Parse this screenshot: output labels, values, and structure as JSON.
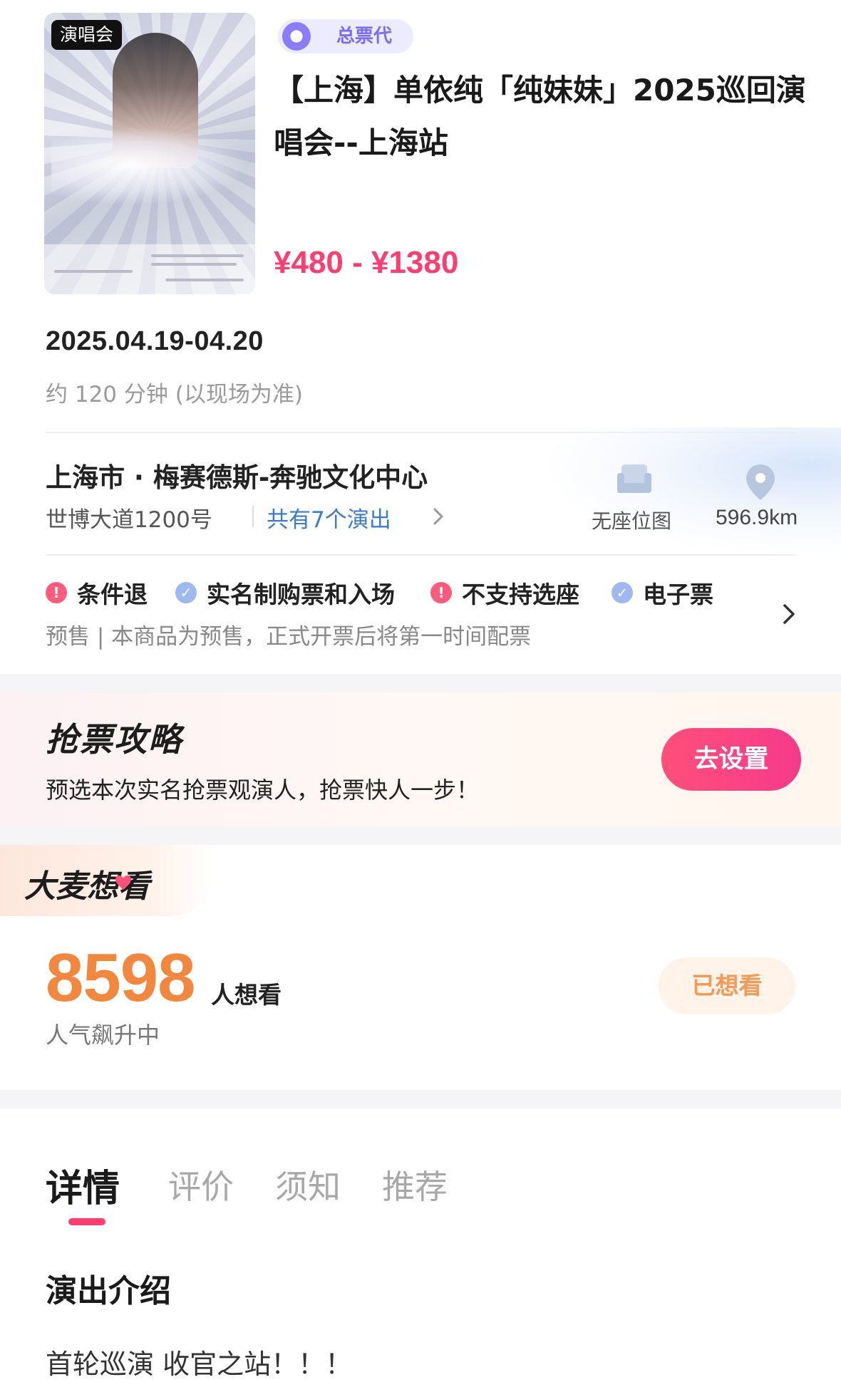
{
  "poster": {
    "category_badge": "演唱会"
  },
  "agent_badge": {
    "label": "总票代"
  },
  "event": {
    "title": "【上海】单依纯「纯妹妹」2025巡回演唱会--上海站",
    "price_range": "¥480 - ¥1380",
    "date": "2025.04.19-04.20",
    "duration": "约 120 分钟 (以现场为准)"
  },
  "venue": {
    "name": "上海市 · 梅赛德斯-奔驰文化中心",
    "address": "世博大道1200号",
    "shows_link": "共有7个演出",
    "seat_map_label": "无座位图",
    "distance": "596.9km"
  },
  "tags": [
    {
      "label": "条件退",
      "kind": "warn"
    },
    {
      "label": "实名制购票和入场",
      "kind": "ok"
    },
    {
      "label": "不支持选座",
      "kind": "warn"
    },
    {
      "label": "电子票",
      "kind": "ok"
    }
  ],
  "presale_note": "预售 | 本商品为预售，正式开票后将第一时间配票",
  "strategy": {
    "title": "抢票攻略",
    "description": "预选本次实名抢票观演人，抢票快人一步！",
    "button": "去设置"
  },
  "want": {
    "title": "大麦想看",
    "count": "8598",
    "count_suffix": "人想看",
    "trend": "人气飙升中",
    "button": "已想看"
  },
  "tabs": [
    "详情",
    "评价",
    "须知",
    "推荐"
  ],
  "details": {
    "section_title": "演出介绍",
    "intro": "首轮巡演 收官之站！！！"
  },
  "colors": {
    "accent": "#ff3d6e",
    "link": "#3a7bd5",
    "want_orange": "#f2873e",
    "agent_purple": "#7a6cf6"
  }
}
